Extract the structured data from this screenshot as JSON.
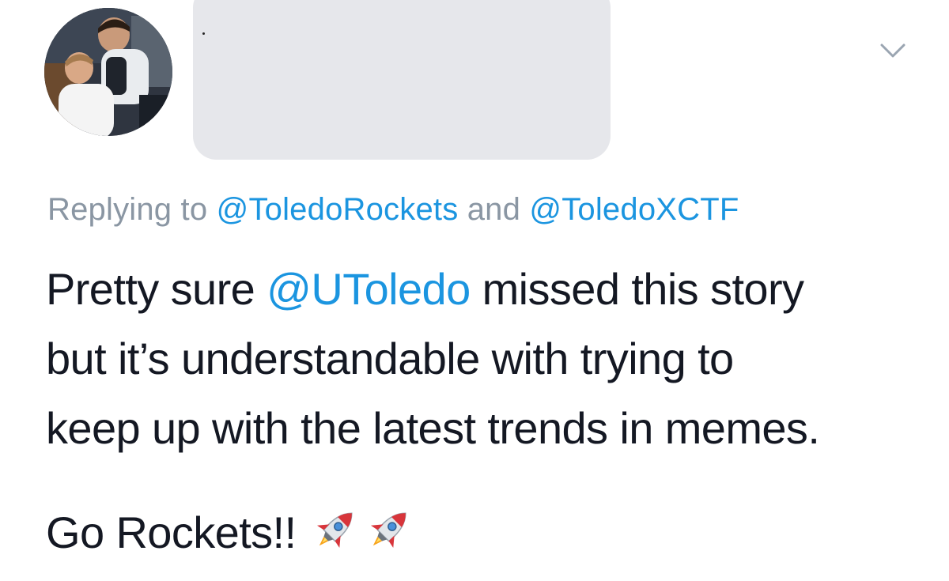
{
  "tweet": {
    "replying": {
      "prefix": "Replying to ",
      "mention_1": "@ToledoRockets",
      "connector": " and ",
      "mention_2": "@ToledoXCTF"
    },
    "body": {
      "line1_pre": "Pretty sure ",
      "line1_mention": "@UToledo",
      "line1_post": " missed this story",
      "line2": "but it’s understandable with trying to",
      "line3": "keep up with the latest trends in memes.",
      "line4": "Go Rockets!! "
    },
    "emoji": [
      "rocket-emoji",
      "rocket-emoji"
    ],
    "icons": {
      "menu": "chevron-down-icon",
      "avatar": "profile-avatar"
    },
    "colors": {
      "link": "#1b95e0",
      "muted": "#8a96a3",
      "text": "#141823",
      "redaction": "#e6e7eb"
    }
  }
}
